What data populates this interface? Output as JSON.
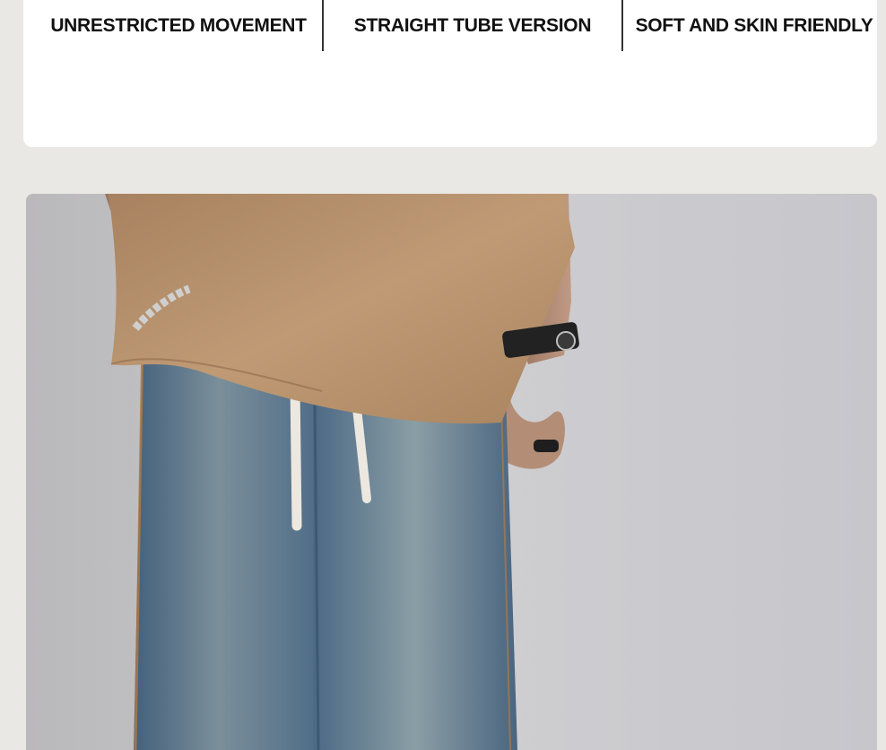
{
  "features": [
    {
      "label": "UNRESTRICTED MOVEMENT"
    },
    {
      "label": "STRAIGHT TUBE VERSION"
    },
    {
      "label": "SOFT AND SKIN FRIENDLY"
    }
  ],
  "colors": {
    "page_background": "#e9e8e4",
    "card_background": "#ffffff",
    "text": "#111111",
    "shirt": "#b58d68",
    "denim": "#5d7a94"
  }
}
